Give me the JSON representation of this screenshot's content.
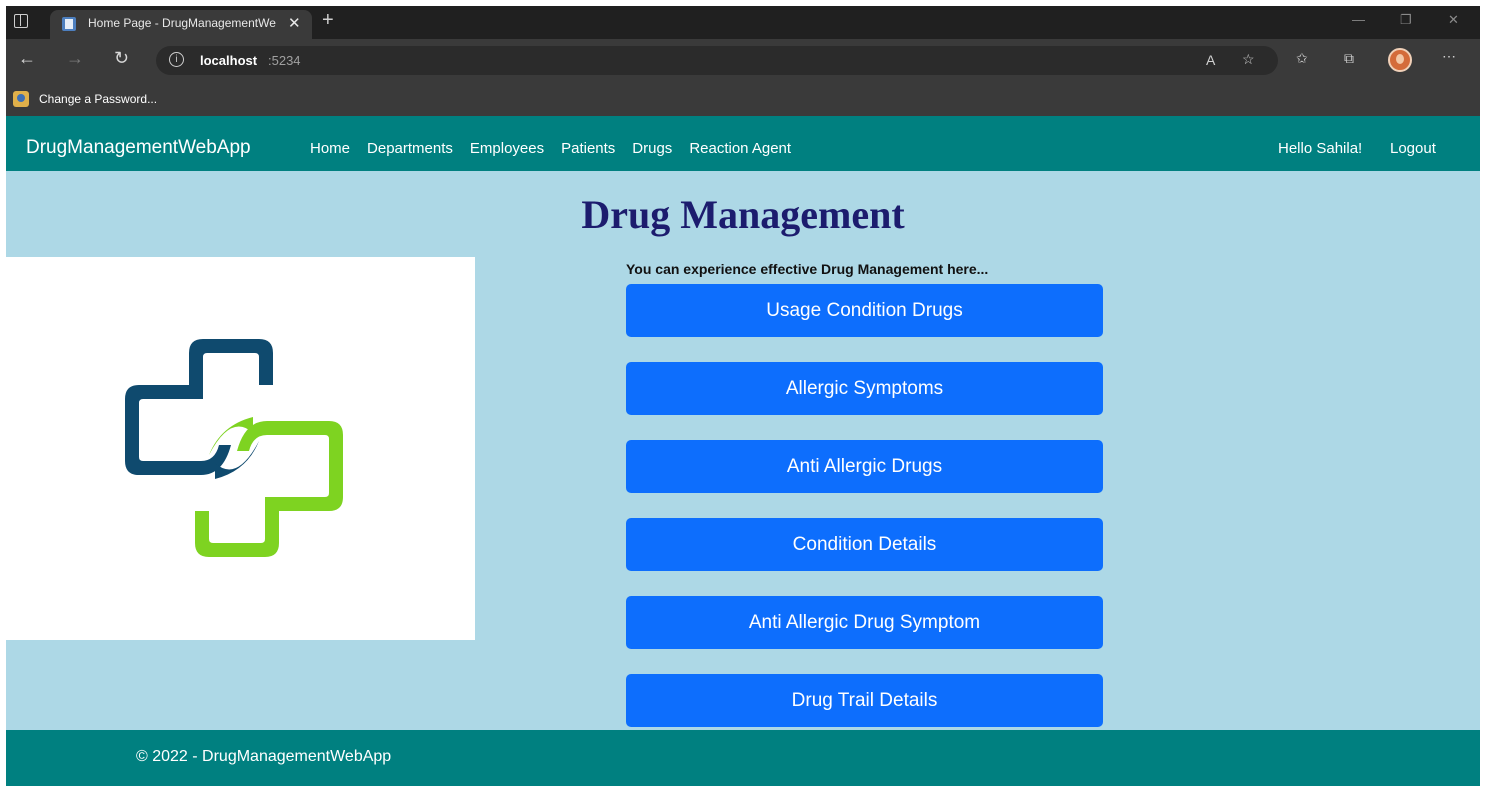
{
  "browser": {
    "tab_title": "Home Page - DrugManagementWe",
    "url_host": "localhost",
    "url_port": ":5234",
    "favorites_item": "Change a Password..."
  },
  "navbar": {
    "brand": "DrugManagementWebApp",
    "links": [
      "Home",
      "Departments",
      "Employees",
      "Patients",
      "Drugs",
      "Reaction Agent"
    ],
    "greeting": "Hello Sahila!",
    "logout": "Logout"
  },
  "main": {
    "title": "Drug Management",
    "tagline": "You can experience effective Drug Management here...",
    "buttons": [
      "Usage Condition Drugs",
      "Allergic Symptoms",
      "Anti Allergic Drugs",
      "Condition Details",
      "Anti Allergic Drug Symptom",
      "Drug Trail Details"
    ]
  },
  "footer": {
    "copyright": "© 2022 - DrugManagementWebApp"
  },
  "colors": {
    "navbar_bg": "#008080",
    "page_bg": "#add8e6",
    "button_bg": "#0d6efd",
    "title_color": "#1c1c6e",
    "logo_navy": "#0f4a6e",
    "logo_green": "#7ed321"
  }
}
